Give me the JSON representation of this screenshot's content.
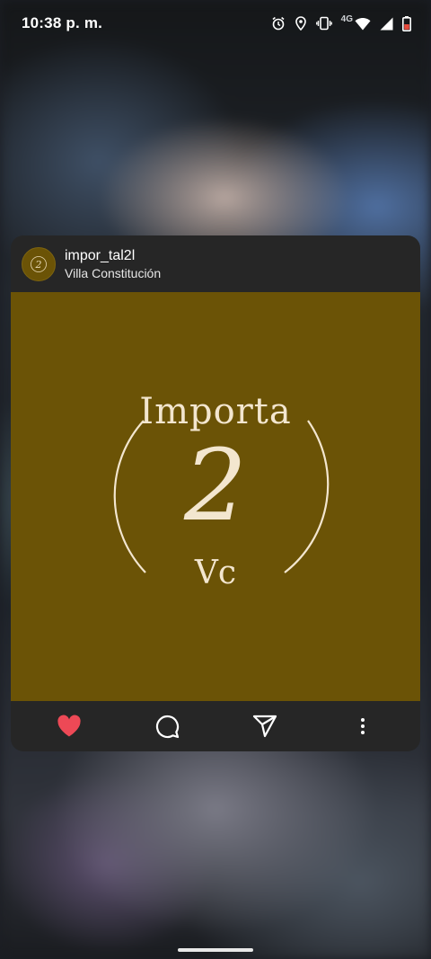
{
  "status_bar": {
    "time": "10:38 p. m.",
    "network_label": "4G",
    "icons": [
      "alarm-icon",
      "location-icon",
      "vibrate-icon",
      "wifi-icon",
      "signal-icon",
      "battery-icon"
    ]
  },
  "post": {
    "username": "impor_tal2l",
    "location": "Villa Constitución",
    "image": {
      "background_color": "#6b5306",
      "logo_text_top": "Importa",
      "logo_number": "2",
      "logo_text_bottom": "Vc"
    },
    "actions": [
      "like-icon",
      "comment-icon",
      "share-icon",
      "more-options-icon"
    ],
    "like_color": "#ed4956"
  }
}
